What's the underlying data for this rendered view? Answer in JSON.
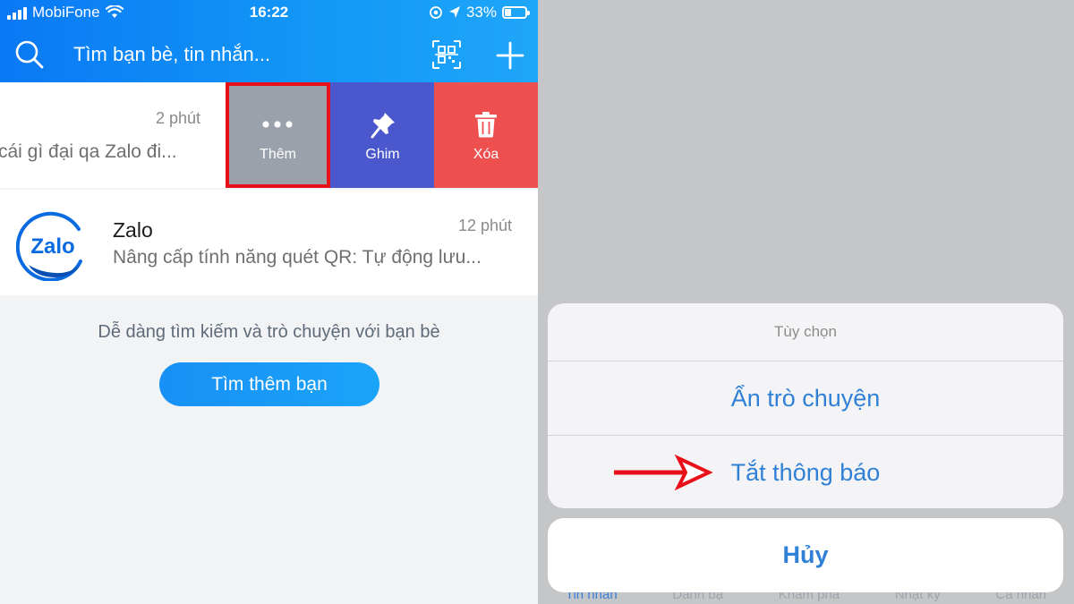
{
  "status_bar": {
    "carrier": "MobiFone",
    "time": "16:22",
    "battery": "33%",
    "battery_level": 0.33
  },
  "header": {
    "search_placeholder": "Tìm bạn bè, tin nhắn...",
    "icons": [
      "search-icon",
      "qr-code-icon",
      "plus-icon"
    ]
  },
  "conversations": [
    {
      "name": "",
      "time": "2 phút",
      "preview": "cái gì đại qa Zalo đi..."
    },
    {
      "name": "Zalo",
      "time": "12 phút",
      "preview": "Nâng cấp tính năng quét QR: Tự động lưu..."
    }
  ],
  "swipe_actions": [
    {
      "label": "Thêm",
      "icon": "more-dots-icon",
      "color": "#9aa1ab"
    },
    {
      "label": "Ghim",
      "icon": "pin-icon",
      "color": "#4a57cd"
    },
    {
      "label": "Xóa",
      "icon": "trash-icon",
      "color": "#ee4f4f"
    }
  ],
  "empty_state": {
    "text": "Dễ dàng tìm kiếm và trò chuyện với bạn bè",
    "button": "Tìm thêm bạn"
  },
  "zalo_logo_text": "Zalo",
  "action_sheet": {
    "title": "Tùy chọn",
    "options": [
      "Ẩn trò chuyện",
      "Tắt thông báo"
    ],
    "cancel": "Hủy"
  },
  "tab_bar": [
    "Tin nhắn",
    "Danh bạ",
    "Khám phá",
    "Nhật ký",
    "Cá nhân"
  ],
  "colors": {
    "accent": "#0a79f4",
    "highlight_box": "#e8111a",
    "arrow": "#e8111a",
    "sheet_text": "#2f80d6"
  }
}
